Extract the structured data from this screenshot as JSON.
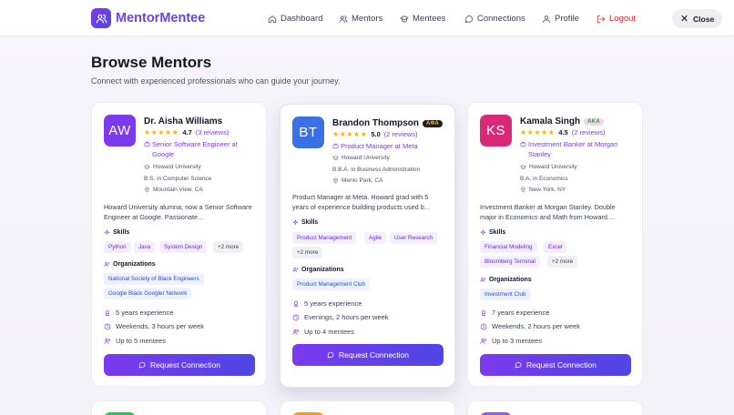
{
  "app": {
    "name": "MentorMentee"
  },
  "nav": {
    "dashboard": "Dashboard",
    "mentors": "Mentors",
    "mentees": "Mentees",
    "connections": "Connections",
    "profile": "Profile",
    "logout": "Logout",
    "close": "Close"
  },
  "page": {
    "title": "Browse Mentors",
    "subtitle": "Connect with experienced professionals who can guide your journey."
  },
  "labels": {
    "skills": "Skills",
    "organizations": "Organizations",
    "request": "Request Connection"
  },
  "mentors": [
    {
      "initials": "AW",
      "name": "Dr. Aisha Williams",
      "badge": "",
      "rating": "4.7",
      "reviews": "(3 reviews)",
      "role": "Senior Software Engineer at Google",
      "school": "Howard University",
      "degree": "B.S. in Computer Science",
      "location": "Mountain View, CA",
      "description": "Howard University alumna, now a Senior Software Engineer at Google. Passionate...",
      "skills": [
        "Python",
        "Java",
        "System Design"
      ],
      "more": "+2 more",
      "organizations": [
        "National Society of Black Engineers",
        "Google Black Googler Network"
      ],
      "experience": "5 years experience",
      "availability": "Weekends, 3 hours per week",
      "capacity": "Up to 5 mentees",
      "color": "#7c3aed"
    },
    {
      "initials": "BT",
      "name": "Brandon Thompson",
      "badge": "ΑΦΑ",
      "rating": "5.0",
      "reviews": "(2 reviews)",
      "role": "Product Manager at Meta",
      "school": "Howard University",
      "degree": "B.B.A. in Business Administration",
      "location": "Menlo Park, CA",
      "description": "Product Manager at Meta. Howard grad with 5 years of experience building products used b...",
      "skills": [
        "Product Management",
        "Agile",
        "User Research"
      ],
      "more": "+2 more",
      "organizations": [
        "Product Management Club"
      ],
      "experience": "5 years experience",
      "availability": "Evenings, 2 hours per week",
      "capacity": "Up to 4 mentees",
      "color": "#3b6fe6"
    },
    {
      "initials": "KS",
      "name": "Kamala Singh",
      "badge": "AKA",
      "rating": "4.5",
      "reviews": "(2 reviews)",
      "role": "Investment Banker at Morgan Stanley",
      "school": "Howard University",
      "degree": "B.A. in Economics",
      "location": "New York, NY",
      "description": "Investment Banker at Morgan Stanley. Double major in Economics and Math from Howard....",
      "skills": [
        "Financial Modeling",
        "Excel",
        "Bloomberg Terminal"
      ],
      "more": "+2 more",
      "organizations": [
        "Investment Club"
      ],
      "experience": "7 years experience",
      "availability": "Weekends, 2 hours per week",
      "capacity": "Up to 3 mentees",
      "color": "#db2777"
    }
  ],
  "next_row_colors": [
    "#22c55e",
    "#f59e0b",
    "#8b5cf6"
  ]
}
